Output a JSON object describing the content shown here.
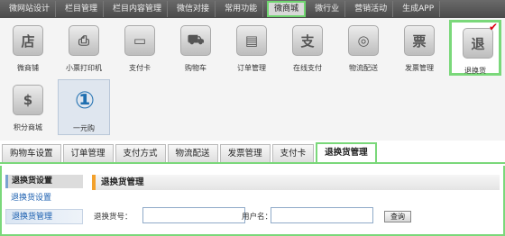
{
  "topnav": {
    "items": [
      "微网站设计",
      "栏目管理",
      "栏目内容管理",
      "微信对接",
      "常用功能",
      "微商城",
      "微行业",
      "营销活动",
      "生成APP"
    ],
    "active_index": 5
  },
  "apps": [
    {
      "label": "微商铺",
      "icon": "store-icon",
      "glyph": "店"
    },
    {
      "label": "小票打印机",
      "icon": "printer-icon",
      "glyph": "⎙"
    },
    {
      "label": "支付卡",
      "icon": "card-icon",
      "glyph": "▭"
    },
    {
      "label": "购物车",
      "icon": "cart-icon",
      "glyph": "⛟"
    },
    {
      "label": "订单管理",
      "icon": "order-icon",
      "glyph": "▤"
    },
    {
      "label": "在线支付",
      "icon": "pay-icon",
      "glyph": "支"
    },
    {
      "label": "物流配送",
      "icon": "steering-wheel-icon",
      "glyph": "◎"
    },
    {
      "label": "发票管理",
      "icon": "invoice-icon",
      "glyph": "票"
    },
    {
      "label": "退换货",
      "icon": "return-icon",
      "glyph": "退"
    },
    {
      "label": "积分商城",
      "icon": "points-store-icon",
      "glyph": "$"
    },
    {
      "label": "一元购",
      "icon": "one-yuan-icon",
      "glyph": "①"
    }
  ],
  "subtabs": [
    "购物车设置",
    "订单管理",
    "支付方式",
    "物流配送",
    "发票管理",
    "支付卡",
    "退换货管理"
  ],
  "sidebar": {
    "header": "退换货设置",
    "items": [
      "退换货设置",
      "退换货管理"
    ]
  },
  "panel": {
    "title": "退换货管理",
    "return_no_label": "退换货号：",
    "username_label": "用户名：",
    "query_label": "查询"
  },
  "colors": {
    "highlight": "#7ad87a",
    "accent_orange": "#f3a12c",
    "link_blue": "#1b5fb0"
  }
}
